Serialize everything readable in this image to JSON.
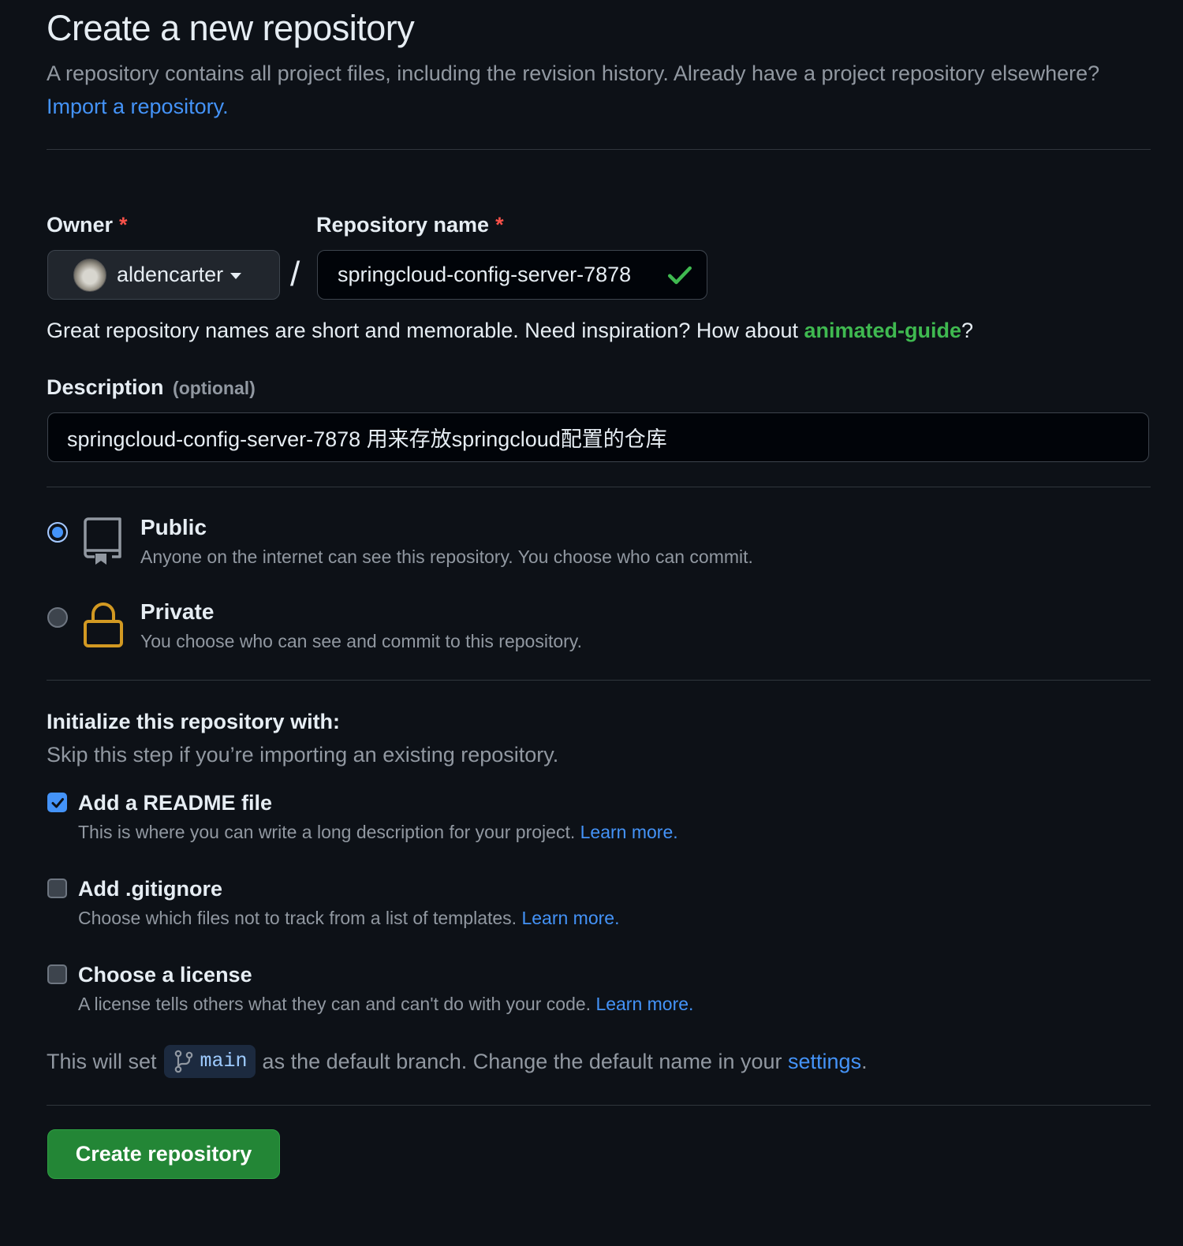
{
  "header": {
    "title": "Create a new repository",
    "intro_text": "A repository contains all project files, including the revision history. Already have a project repository elsewhere?",
    "import_link": "Import a repository."
  },
  "owner": {
    "label": "Owner",
    "required_mark": "*",
    "value": "aldencarter"
  },
  "repo_name": {
    "label": "Repository name",
    "required_mark": "*",
    "value": "springcloud-config-server-7878",
    "separator": "/"
  },
  "name_hint": {
    "prefix": "Great repository names are short and memorable. Need inspiration? How about ",
    "suggestion": "animated-guide",
    "suffix": "?"
  },
  "description": {
    "label": "Description",
    "optional": "(optional)",
    "value": "springcloud-config-server-7878 用来存放springcloud配置的仓库"
  },
  "visibility": {
    "options": [
      {
        "title": "Public",
        "subtitle": "Anyone on the internet can see this repository. You choose who can commit.",
        "selected": true
      },
      {
        "title": "Private",
        "subtitle": "You choose who can see and commit to this repository.",
        "selected": false
      }
    ]
  },
  "initialize": {
    "title": "Initialize this repository with:",
    "subtitle": "Skip this step if you’re importing an existing repository.",
    "options": [
      {
        "title": "Add a README file",
        "subtitle": "This is where you can write a long description for your project.",
        "link": "Learn more.",
        "checked": true
      },
      {
        "title": "Add .gitignore",
        "subtitle": "Choose which files not to track from a list of templates.",
        "link": "Learn more.",
        "checked": false
      },
      {
        "title": "Choose a license",
        "subtitle": "A license tells others what they can and can't do with your code.",
        "link": "Learn more.",
        "checked": false
      }
    ]
  },
  "branch": {
    "prefix": "This will set",
    "name": "main",
    "middle": "as the default branch. Change the default name in your",
    "settings_link": "settings",
    "suffix": "."
  },
  "submit": {
    "label": "Create repository"
  },
  "colors": {
    "background": "#0d1117",
    "link": "#4493f8",
    "success": "#3fb950",
    "button": "#238636",
    "lock": "#d29922",
    "required": "#f85149"
  },
  "icons": {
    "owner_caret": "caret-down-icon",
    "valid": "check-icon",
    "public": "repo-icon",
    "private": "lock-icon",
    "branch": "git-branch-icon"
  }
}
